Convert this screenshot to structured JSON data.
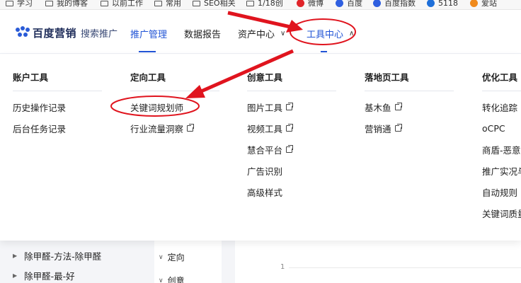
{
  "bookmarks": [
    {
      "label": "学习",
      "icon": "folder-icon"
    },
    {
      "label": "我的博客",
      "icon": "folder-icon"
    },
    {
      "label": "以前工作",
      "icon": "folder-icon"
    },
    {
      "label": "常用",
      "icon": "folder-icon"
    },
    {
      "label": "SEO相关",
      "icon": "folder-icon"
    },
    {
      "label": "1/18创",
      "icon": "folder-icon"
    },
    {
      "label": "微博",
      "icon": "weibo-icon"
    },
    {
      "label": "百度",
      "icon": "baidu-icon"
    },
    {
      "label": "百度指数",
      "icon": "baidu-icon"
    },
    {
      "label": "5118",
      "icon": "5118-icon"
    },
    {
      "label": "爱站",
      "icon": "aizhan-icon"
    }
  ],
  "header": {
    "logo_name": "百度营销",
    "logo_sub": "搜索推广",
    "nav": [
      {
        "label": "推广管理",
        "active": true
      },
      {
        "label": "数据报告",
        "active": false
      },
      {
        "label": "资产中心",
        "active": false,
        "chevron": "chevron-down-icon"
      },
      {
        "label": "工具中心",
        "active": true,
        "chevron": "chevron-up-icon"
      }
    ]
  },
  "menu": {
    "columns": [
      {
        "title": "账户工具",
        "items": [
          {
            "label": "历史操作记录",
            "external": false
          },
          {
            "label": "后台任务记录",
            "external": false
          }
        ]
      },
      {
        "title": "定向工具",
        "items": [
          {
            "label": "关键词规划师",
            "external": false
          },
          {
            "label": "行业流量洞察",
            "external": true
          }
        ]
      },
      {
        "title": "创意工具",
        "items": [
          {
            "label": "图片工具",
            "external": true
          },
          {
            "label": "视频工具",
            "external": true
          },
          {
            "label": "慧合平台",
            "external": true
          },
          {
            "label": "广告识别",
            "external": false
          },
          {
            "label": "高级样式",
            "external": false
          }
        ]
      },
      {
        "title": "落地页工具",
        "items": [
          {
            "label": "基木鱼",
            "external": true
          },
          {
            "label": "营销通",
            "external": true
          }
        ]
      },
      {
        "title": "优化工具",
        "items": [
          {
            "label": "转化追踪",
            "external": false
          },
          {
            "label": "oCPC",
            "external": false
          },
          {
            "label": "商盾-恶意",
            "external": false
          },
          {
            "label": "推广实况与",
            "external": false
          },
          {
            "label": "自动规则",
            "external": false
          },
          {
            "label": "关键词质量",
            "external": false
          }
        ]
      }
    ]
  },
  "background": {
    "tree": [
      "除甲醛-方法-除甲醛",
      "除甲醛-最-好"
    ],
    "sub_items": [
      "定向",
      "创意"
    ],
    "chart_tick": "1"
  },
  "colors": {
    "accent": "#2255d6",
    "annotation_red": "#e0141e"
  }
}
